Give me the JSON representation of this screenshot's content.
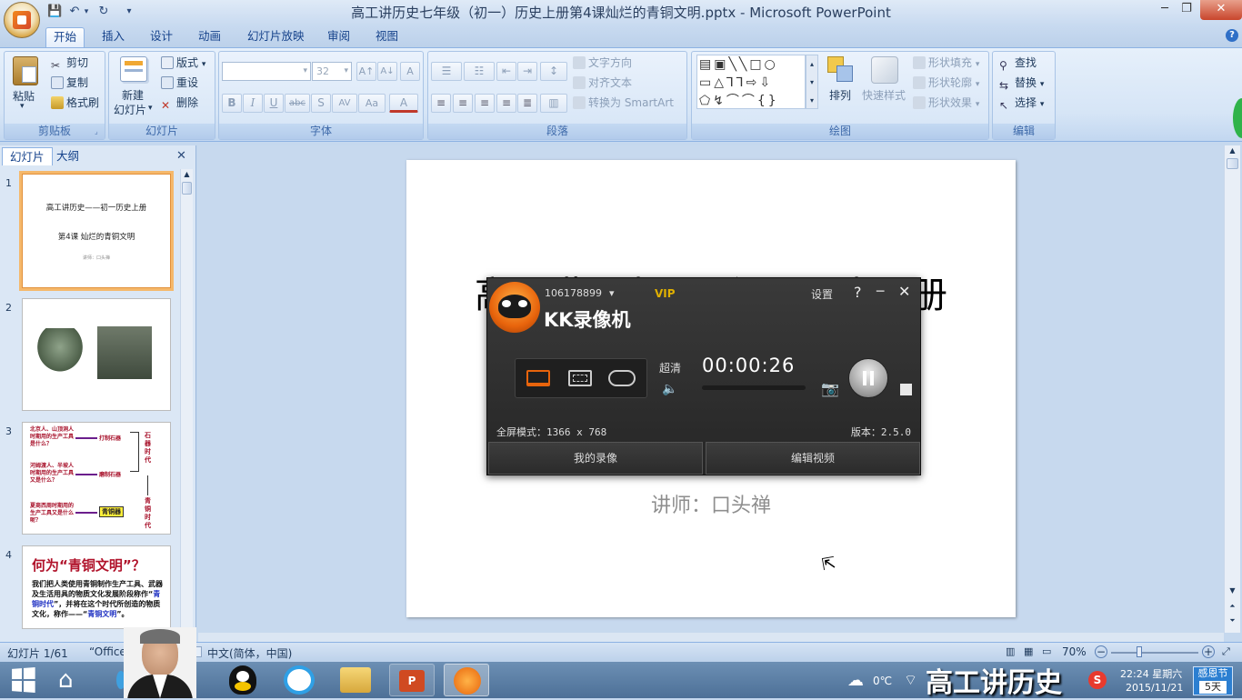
{
  "window": {
    "title": "高工讲历史七年级（初一）历史上册第4课灿烂的青铜文明.pptx - Microsoft PowerPoint",
    "min": "─",
    "max": "❐",
    "close": "✕"
  },
  "quick_access": {
    "save": "💾",
    "undo": "↶",
    "redo": "↻",
    "more": "▾"
  },
  "tabs": [
    "开始",
    "插入",
    "设计",
    "动画",
    "幻灯片放映",
    "审阅",
    "视图"
  ],
  "help_icon": "?",
  "ribbon": {
    "clipboard": {
      "label": "剪贴板",
      "paste": "粘贴",
      "cut": "剪切",
      "copy": "复制",
      "format_painter": "格式刷"
    },
    "slides": {
      "label": "幻灯片",
      "new_slide": "新建",
      "new_slide2": "幻灯片",
      "layout": "版式",
      "reset": "重设",
      "delete": "删除"
    },
    "font": {
      "label": "字体",
      "font_size": "32",
      "bold": "B",
      "italic": "I",
      "underline": "U",
      "strike": "abc",
      "shadow": "S",
      "spacing": "AV",
      "case": "Aa",
      "color": "A",
      "grow": "A↑",
      "shrink": "A↓",
      "clear": "A"
    },
    "paragraph": {
      "label": "段落",
      "text_direction": "文字方向",
      "align_text": "对齐文本",
      "smartart": "转换为 SmartArt"
    },
    "drawing": {
      "label": "绘图",
      "arrange": "排列",
      "quick_styles": "快速样式",
      "fill": "形状填充",
      "outline": "形状轮廓",
      "effects": "形状效果"
    },
    "editing": {
      "label": "编辑",
      "find": "查找",
      "replace": "替换",
      "select": "选择"
    }
  },
  "left_panel": {
    "tab_slides": "幻灯片",
    "tab_outline": "大纲",
    "close": "✕",
    "slides": [
      {
        "num": "1",
        "title": "高工讲历史——初一历史上册",
        "subtitle": "第4课 灿烂的青铜文明",
        "lecturer": "讲师：口头禅"
      },
      {
        "num": "2"
      },
      {
        "num": "3",
        "q1": "北京人、山顶洞人时期用的生产工具是什么？",
        "a1": "打制石器",
        "q2": "河姆渡人、半坡人时期用的生产工具又是什么？",
        "a2": "磨制石器",
        "q3": "夏商西周时期用的生产工具又是什么呢？",
        "a3": "青铜器",
        "era1": "石器时代",
        "era2": "青铜时代"
      },
      {
        "num": "4",
        "heading": "何为“青铜文明”？",
        "body1": "我们把人类使用青铜制作生产工具、武器及生活用具的物质文化发展阶段称作“",
        "hl1": "青铜时代",
        "body2": "”，并将在这个时代所创造的物质文化，称作——“",
        "hl2": "青铜文明",
        "body3": "”。"
      }
    ]
  },
  "slide": {
    "title": "高工讲历史——初一历史上册",
    "lecturer": "讲师：口头禅"
  },
  "kk": {
    "account": "106178899",
    "vip": "VIP",
    "settings": "设置",
    "help": "?",
    "min": "─",
    "close": "✕",
    "brand": "KK录像机",
    "quality": "超清",
    "timer": "00:00:26",
    "mode": "全屏模式：1366 x 768",
    "version": "版本：2.5.0",
    "my_recordings": "我的录像",
    "edit_video": "编辑视频"
  },
  "statusbar": {
    "slide_info": "幻灯片 1/61",
    "theme": "“Office",
    "language": "中文(简体，中国)",
    "zoom": "70%"
  },
  "taskbar": {
    "temperature": "0℃",
    "watermark": "高工讲历史",
    "time": "22:24 星期六",
    "date": "2015/11/21",
    "badge_title": "感恩节",
    "badge_days": "5天"
  },
  "colors": {
    "accent_blue": "#15428b",
    "highlight_orange": "#f5b86b",
    "kk_orange": "#e8640c"
  }
}
